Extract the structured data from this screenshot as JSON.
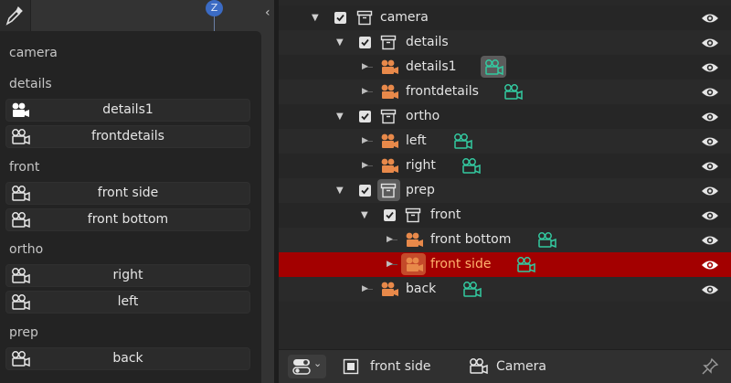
{
  "viewport": {
    "axis_label": "Z",
    "collapse_glyph": "‹"
  },
  "menu": {
    "groups": [
      {
        "heading": "camera",
        "items": []
      },
      {
        "heading": "details",
        "items": [
          {
            "label": "details1",
            "icon": "camera-object-icon"
          },
          {
            "label": "frontdetails",
            "icon": "camera-data-icon"
          }
        ]
      },
      {
        "heading": "front",
        "items": [
          {
            "label": "front side",
            "icon": "camera-data-icon"
          },
          {
            "label": "front bottom",
            "icon": "camera-data-icon"
          }
        ]
      },
      {
        "heading": "ortho",
        "items": [
          {
            "label": "right",
            "icon": "camera-data-icon"
          },
          {
            "label": "left",
            "icon": "camera-data-icon"
          }
        ]
      },
      {
        "heading": "prep",
        "items": [
          {
            "label": "back",
            "icon": "camera-data-icon"
          }
        ]
      }
    ]
  },
  "outliner": {
    "rows": [
      {
        "label": "camera",
        "type": "collection",
        "expanded": true,
        "checked": true
      },
      {
        "label": "details",
        "type": "collection",
        "expanded": true,
        "checked": true
      },
      {
        "label": "details1",
        "type": "camera-object",
        "data_icon_active": true
      },
      {
        "label": "frontdetails",
        "type": "camera-object"
      },
      {
        "label": "ortho",
        "type": "collection",
        "expanded": true,
        "checked": true
      },
      {
        "label": "left",
        "type": "camera-object"
      },
      {
        "label": "right",
        "type": "camera-object"
      },
      {
        "label": "prep",
        "type": "collection",
        "expanded": true,
        "checked": true,
        "icon_active": true
      },
      {
        "label": "front",
        "type": "collection",
        "expanded": true,
        "checked": true
      },
      {
        "label": "front bottom",
        "type": "camera-object"
      },
      {
        "label": "front side",
        "type": "camera-object",
        "selected": true
      },
      {
        "label": "back",
        "type": "camera-object"
      }
    ],
    "colors": {
      "selected_row": "#a30000",
      "selected_text": "#ffb36e",
      "camera_object": "#e8894a",
      "camera_data": "#33c9a0"
    }
  },
  "footer": {
    "active_object": "front side",
    "active_data": "Camera",
    "icons": [
      "filter-toggle-icon",
      "object-icon",
      "camera-data-icon",
      "pin-icon"
    ]
  }
}
